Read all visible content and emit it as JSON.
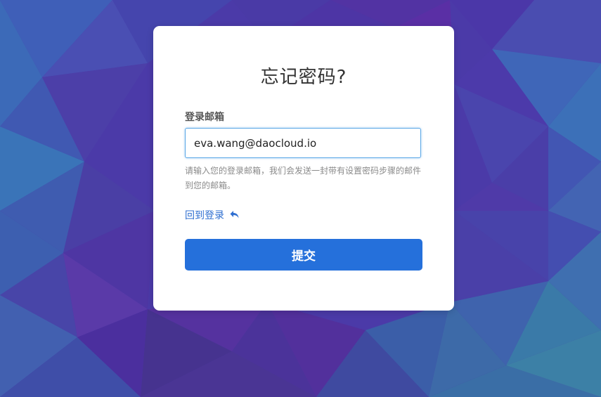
{
  "page": {
    "title": "忘记密码?"
  },
  "form": {
    "email_label": "登录邮箱",
    "email_value": "eva.wang@daocloud.io",
    "help_text": "请输入您的登录邮箱，我们会发送一封带有设置密码步骤的邮件到您的邮箱。",
    "back_link_label": "回到登录",
    "back_link_icon": "undo-arrow-icon",
    "submit_label": "提交"
  },
  "colors": {
    "accent": "#2570db",
    "link": "#2f6fd0",
    "background_primary": "#4b3aa8",
    "background_secondary": "#3d6bb0"
  }
}
